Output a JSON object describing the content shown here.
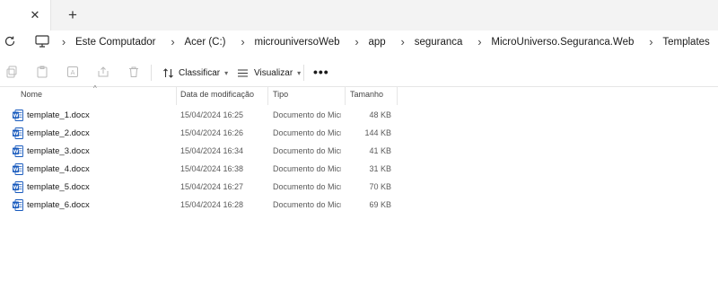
{
  "tabs": {
    "close_icon": "close-icon",
    "add_icon": "plus-icon"
  },
  "address": {
    "breadcrumb": [
      "Este Computador",
      "Acer (C:)",
      "microuniversoWeb",
      "app",
      "seguranca",
      "MicroUniverso.Seguranca.Web",
      "Templates"
    ]
  },
  "toolbar": {
    "sort_label": "Classificar",
    "view_label": "Visualizar",
    "more_label": "•••"
  },
  "columns": {
    "name": "Nome",
    "date": "Data de modificação",
    "type": "Tipo",
    "size": "Tamanho"
  },
  "files": [
    {
      "name": "template_1.docx",
      "date": "15/04/2024 16:25",
      "type": "Documento do Microsoft Word",
      "size": "48 KB"
    },
    {
      "name": "template_2.docx",
      "date": "15/04/2024 16:26",
      "type": "Documento do Microsoft Word",
      "size": "144 KB"
    },
    {
      "name": "template_3.docx",
      "date": "15/04/2024 16:34",
      "type": "Documento do Microsoft Word",
      "size": "41 KB"
    },
    {
      "name": "template_4.docx",
      "date": "15/04/2024 16:38",
      "type": "Documento do Microsoft Word",
      "size": "31 KB"
    },
    {
      "name": "template_5.docx",
      "date": "15/04/2024 16:27",
      "type": "Documento do Microsoft Word",
      "size": "70 KB"
    },
    {
      "name": "template_6.docx",
      "date": "15/04/2024 16:28",
      "type": "Documento do Microsoft Word",
      "size": "69 KB"
    }
  ],
  "colors": {
    "word_blue": "#185abd",
    "accent": "#0067c0"
  }
}
